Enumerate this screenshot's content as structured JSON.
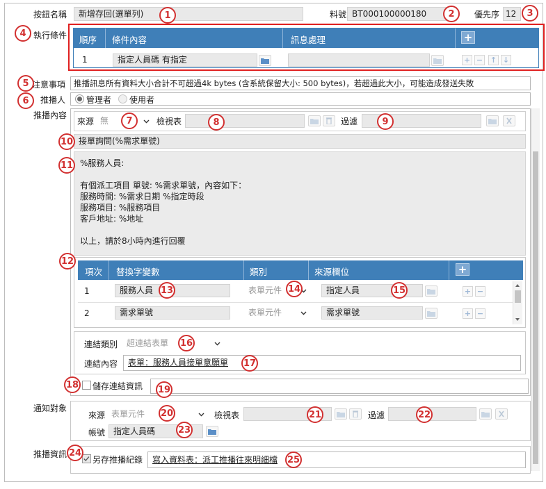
{
  "header": {
    "button_name_label": "按鈕名稱",
    "button_name_value": "新增存回(選單列)",
    "material_no_label": "料號",
    "material_no_value": "BT000100000180",
    "priority_label": "優先序",
    "priority_value": "12"
  },
  "exec_conditions": {
    "label": "執行條件",
    "columns": [
      "順序",
      "條件內容",
      "訊息處理"
    ],
    "add_symbol": "+",
    "rows": [
      {
        "order": "1",
        "condition": "指定人員碼 有指定",
        "message": ""
      }
    ]
  },
  "notice": {
    "label": "注意事項",
    "text": "推播訊息所有資料大小合計不可超過4k bytes (含系統保留大小: 500 bytes)，若超過此大小，可能造成發送失敗"
  },
  "pusher": {
    "label": "推播人",
    "options": [
      "管理者",
      "使用者"
    ],
    "selected": "管理者"
  },
  "push_content": {
    "label": "推播內容",
    "source_label": "來源",
    "source_value": "無",
    "view_label": "檢視表",
    "view_value": "",
    "filter_label": "過濾",
    "filter_value": "",
    "subject": "接單詢問(%需求單號)",
    "body_lines": [
      "%服務人員:",
      "",
      "有個派工項目 單號: %需求單號，內容如下：",
      "服務時間: %需求日期 %指定時段",
      "服務項目: %服務項目",
      "客戶地址: %地址",
      "",
      "以上，請於8小時內進行回覆"
    ]
  },
  "variables": {
    "columns": [
      "項次",
      "替換字變數",
      "類別",
      "來源欄位"
    ],
    "add_symbol": "+",
    "rows": [
      {
        "index": "1",
        "variable": "服務人員",
        "category": "表單元件",
        "source": "指定人員"
      },
      {
        "index": "2",
        "variable": "需求單號",
        "category": "表單元件",
        "source": "需求單號"
      }
    ]
  },
  "link": {
    "type_label": "連結類別",
    "type_value": "超連結表單",
    "content_label": "連結內容",
    "content_value": "表單：服務人員接單意願單",
    "save_link_label": "儲存連結資訊",
    "save_link_value": ""
  },
  "notify": {
    "label": "通知對象",
    "source_label": "來源",
    "source_value": "表單元件",
    "view_label": "檢視表",
    "view_value": "",
    "filter_label": "過濾",
    "filter_value": "",
    "account_label": "帳號",
    "account_value": "指定人員碼"
  },
  "push_info": {
    "label": "推播資訊",
    "save_record_label": "另存推播紀錄",
    "save_record_checked": true,
    "record_value": "寫入資料表：派工推播往來明細檔"
  },
  "callouts": [
    "1",
    "2",
    "3",
    "4",
    "5",
    "6",
    "7",
    "8",
    "9",
    "10",
    "11",
    "12",
    "13",
    "14",
    "15",
    "16",
    "17",
    "18",
    "19",
    "20",
    "21",
    "22",
    "23",
    "24",
    "25"
  ],
  "colors": {
    "header_blue": "#3f7fb8",
    "callout_red": "#d23030",
    "field_grey": "#e9e9e9"
  }
}
